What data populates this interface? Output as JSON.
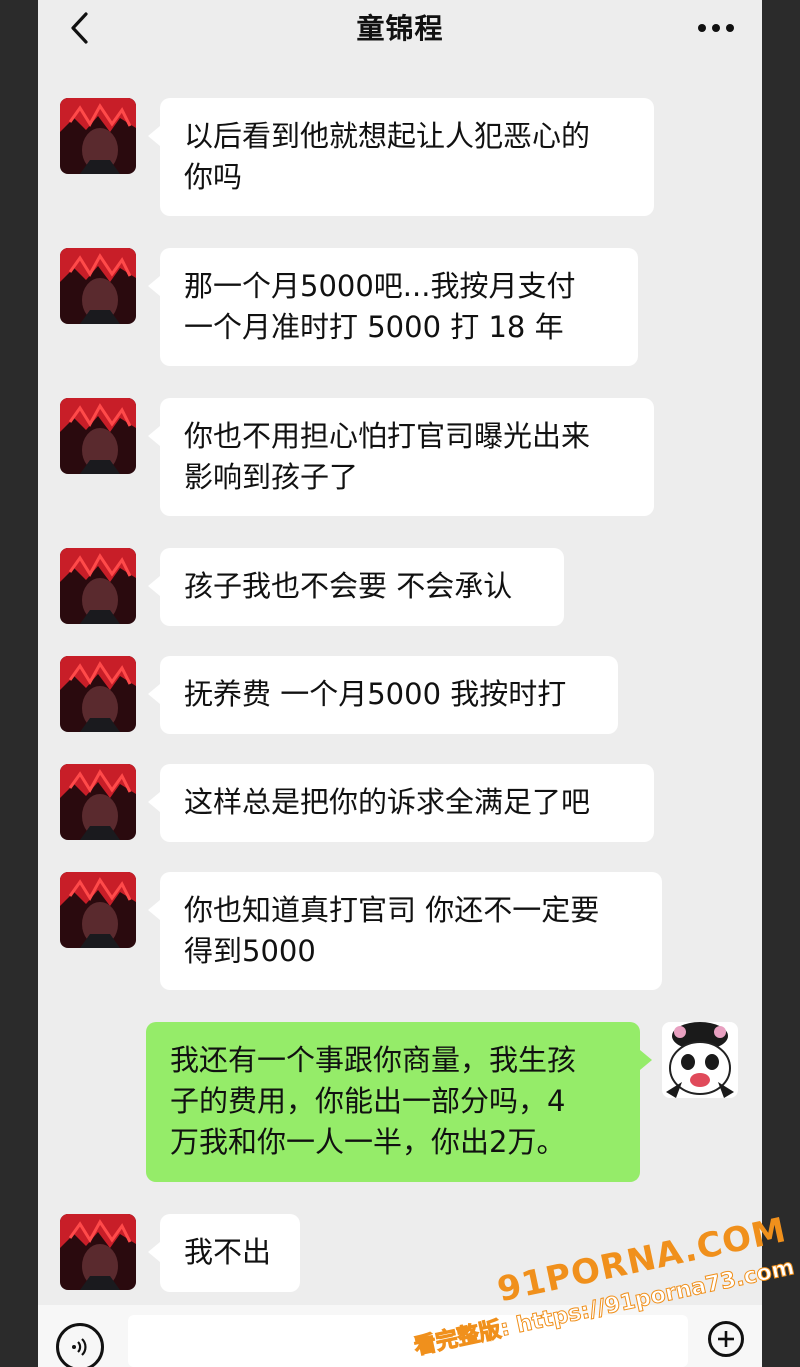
{
  "header": {
    "title": "童锦程",
    "back_icon": "chevron-left-icon",
    "more_icon": "more-dots-icon"
  },
  "messages": [
    {
      "side": "in",
      "lines": [
        "以后看到他就想起让人犯恶心的",
        "你吗"
      ]
    },
    {
      "side": "in",
      "lines": [
        "那一个月5000吧...我按月支付",
        "一个月准时打 5000 打 18 年"
      ]
    },
    {
      "side": "in",
      "lines": [
        "你也不用担心怕打官司曝光出来",
        "影响到孩子了"
      ]
    },
    {
      "side": "in",
      "lines": [
        "孩子我也不会要 不会承认"
      ]
    },
    {
      "side": "in",
      "lines": [
        "抚养费 一个月5000 我按时打"
      ]
    },
    {
      "side": "in",
      "lines": [
        "这样总是把你的诉求全满足了吧"
      ]
    },
    {
      "side": "in",
      "lines": [
        "你也知道真打官司 你还不一定要",
        "得到5000"
      ]
    },
    {
      "side": "out",
      "lines": [
        "我还有一个事跟你商量，我生孩",
        "子的费用，你能出一部分吗，4",
        "万我和你一人一半，你出2万。"
      ]
    },
    {
      "side": "in",
      "lines": [
        "我不出"
      ]
    }
  ],
  "colors": {
    "background": "#ededed",
    "incoming_bubble": "#ffffff",
    "outgoing_bubble": "#95ec69",
    "watermark": "#f0901c"
  },
  "watermark": {
    "brand": "91PORNA.COM",
    "url_line": "看完整版: https://91porna73.com"
  }
}
